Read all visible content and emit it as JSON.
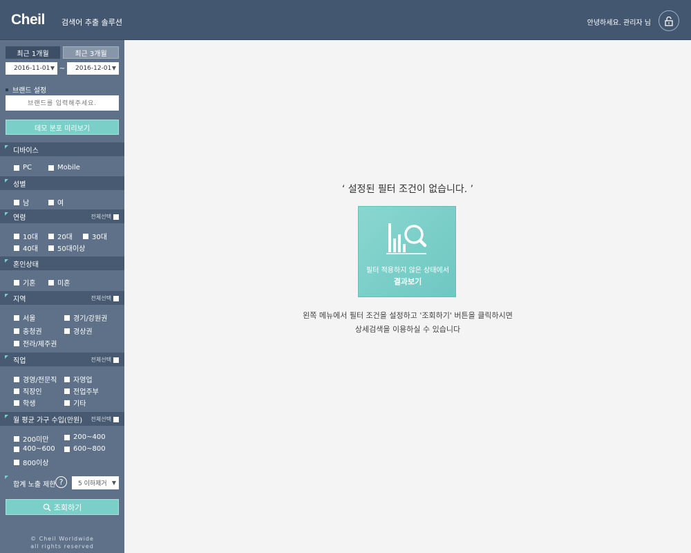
{
  "header": {
    "logo": "Cheil",
    "subtitle": "검색어 추출 솔루션",
    "greeting": "안녕하세요. 관리자 님"
  },
  "sidebar": {
    "period_1m": "최근 1개월",
    "period_3m": "최근 3개월",
    "date_from": "2016-11-01",
    "date_tilde": "~",
    "date_to": "2016-12-01",
    "brand_label": "브랜드 설정",
    "brand_placeholder": "브랜드를 입력해주세요.",
    "demo_button": "데모 분포 미리보기",
    "select_all": "전체선택",
    "sections": {
      "device": {
        "title": "디바이스",
        "options": [
          "PC",
          "Mobile"
        ]
      },
      "gender": {
        "title": "성별",
        "options": [
          "남",
          "여"
        ]
      },
      "age": {
        "title": "연령",
        "options": [
          "10대",
          "20대",
          "30대",
          "40대",
          "50대이상"
        ]
      },
      "marital": {
        "title": "혼인상태",
        "options": [
          "기혼",
          "미혼"
        ]
      },
      "region": {
        "title": "지역",
        "options": [
          "서울",
          "경기/강원권",
          "충청권",
          "경상권",
          "전라/제주권"
        ]
      },
      "job": {
        "title": "직업",
        "options": [
          "경영/전문직",
          "자영업",
          "직장인",
          "전업주부",
          "학생",
          "기타"
        ]
      },
      "income": {
        "title": "월 평균 가구 수입(만원)",
        "options": [
          "200미만",
          "200~400",
          "400~600",
          "600~800",
          "800이상"
        ]
      }
    },
    "limit_label": "합계 노출 제한",
    "help": "?",
    "limit_value": "5 이하제거",
    "search_button": "조회하기",
    "copyright_line1": "© Cheil Worldwide",
    "copyright_line2": "all rights reserved"
  },
  "main": {
    "empty_title": "‘ 설정된 필터 조건이 없습니다. ’",
    "card_line1": "필터 적용하지 않은 상태에서",
    "card_line2": "결과보기",
    "desc_line1": "왼쪽 메뉴에서 필터 조건을 설정하고 '조회하기' 버튼을 클릭하시면",
    "desc_line2": "상세검색을 이용하실 수 있습니다"
  },
  "colors": {
    "header_bg": "#435770",
    "sidebar_bg": "#5e7189",
    "section_bg": "#485a71",
    "accent": "#7acfc8",
    "main_bg": "#f4f4f4"
  },
  "icons": [
    "lock-icon",
    "dropdown-arrow-icon",
    "help-icon",
    "search-icon",
    "chart-magnifier-icon"
  ]
}
